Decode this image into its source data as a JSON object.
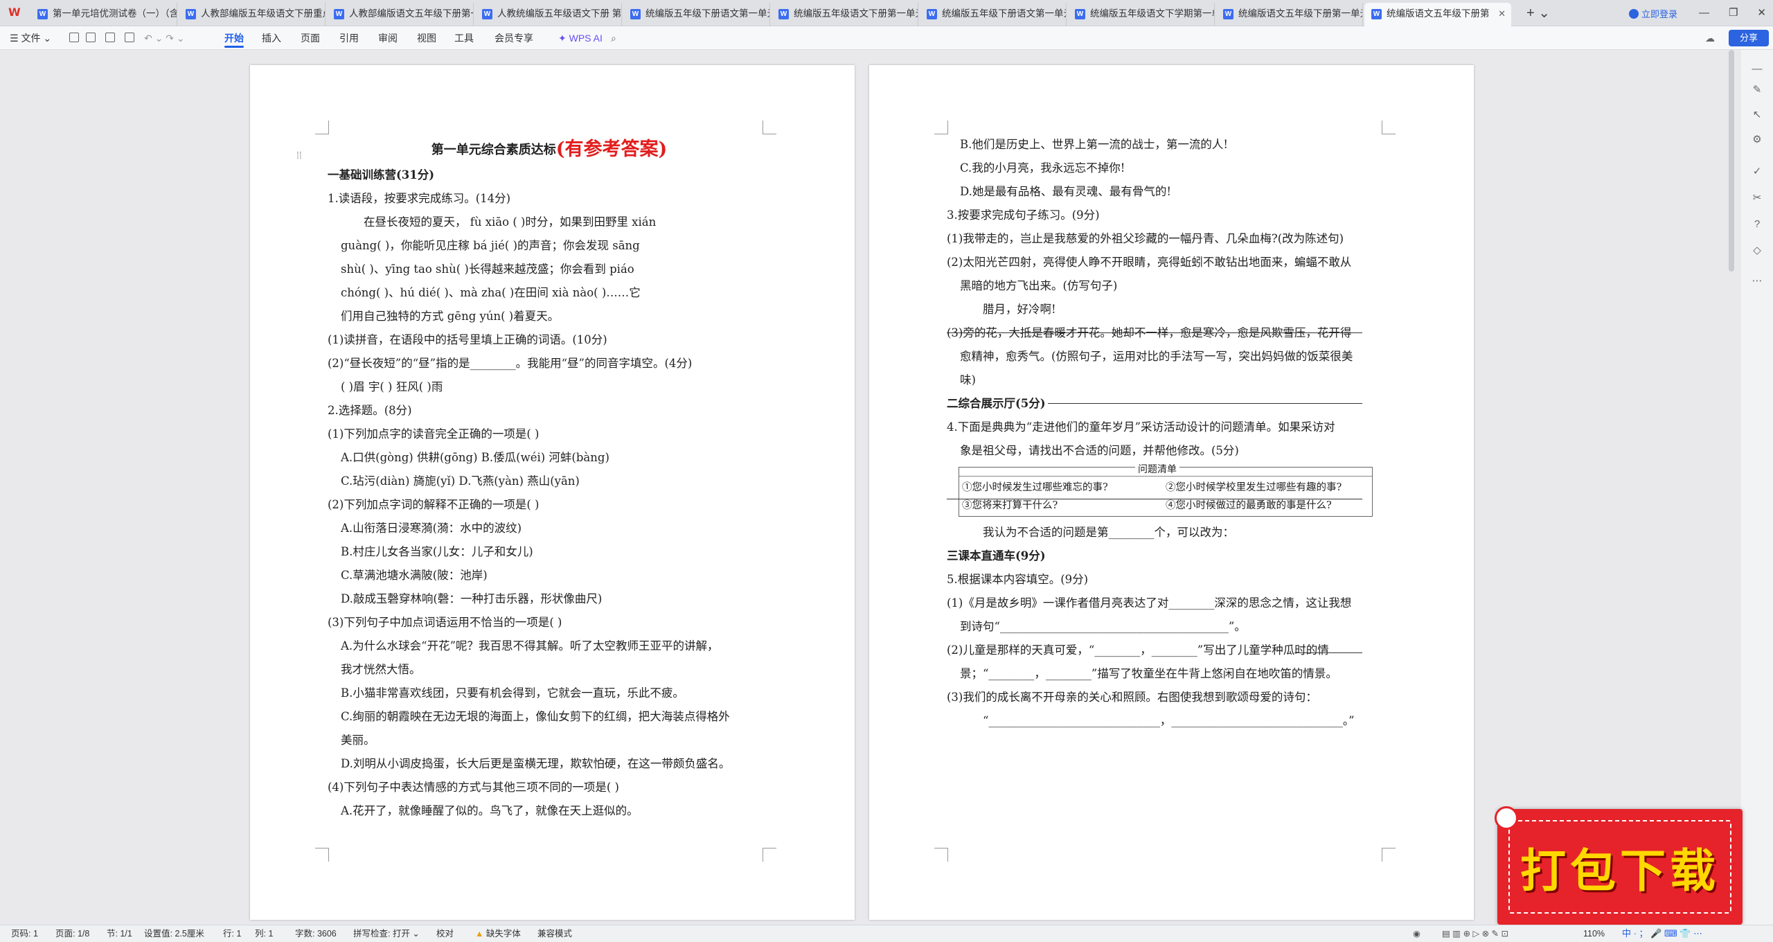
{
  "tabs": [
    {
      "label": "第一单元培优测试卷（一）（含"
    },
    {
      "label": "人教部编版五年级语文下册重点"
    },
    {
      "label": "人教部编版语文五年级下册第一"
    },
    {
      "label": "人教统编版五年级语文下册 第1"
    },
    {
      "label": "统编版五年级下册语文第一单元"
    },
    {
      "label": "统编版五年级语文下册第一单元"
    },
    {
      "label": "统编版五年级下册语文第一单元"
    },
    {
      "label": "统编版五年级语文下学期第一单"
    },
    {
      "label": "统编版语文五年级下册第一单元"
    },
    {
      "label": "统编版语文五年级下册第"
    }
  ],
  "login": "立即登录",
  "menu": {
    "file": "文件",
    "tabs": [
      "开始",
      "插入",
      "页面",
      "引用",
      "审阅",
      "视图",
      "工具",
      "会员专享"
    ],
    "wps_ai": "WPS AI",
    "share": "分享"
  },
  "left": {
    "title": "第一单元综合素质达标",
    "title_red": "(有参考答案)",
    "lines": [
      {
        "c": "h",
        "t": "一基础训练营(31分)"
      },
      {
        "c": "",
        "t": "1.读语段，按要求完成练习。(14分)"
      },
      {
        "c": "ind2",
        "t": "在昼长夜短的夏天，  fù xiāo (          )时分，如果到田野里 xián"
      },
      {
        "c": "ind1",
        "t": "guàng(          )，你能听见庄稼 bá jié(          )的声音；你会发现 sāng"
      },
      {
        "c": "ind1",
        "t": "shù(          )、yīng tao shù(          )长得越来越茂盛；你会看到 piáo"
      },
      {
        "c": "ind1",
        "t": "chóng(          )、hú dié(          )、mà zha(          )在田间 xià nào(          )……它"
      },
      {
        "c": "ind1",
        "t": "们用自己独特的方式 gēng yún(          )着夏天。"
      },
      {
        "c": "",
        "t": "(1)读拼音，在语段中的括号里填上正确的词语。(10分)"
      },
      {
        "c": "",
        "t": "(2)“昼长夜短”的“昼”指的是________。我能用“昼”的同音字填空。(4分)"
      },
      {
        "c": "ind1",
        "t": "(          )眉              宇(          )              狂风(          )雨"
      },
      {
        "c": "",
        "t": "2.选择题。(8分)"
      },
      {
        "c": "",
        "t": "(1)下列加点字的读音完全正确的一项是(      )"
      },
      {
        "c": "ind1",
        "t": "A.口供(gòng)        供耕(gōng) B.倭瓜(wéi)    河蚌(bàng)"
      },
      {
        "c": "ind1",
        "t": "C.玷污(diàn)          旖旎(yǐ)        D.飞燕(yàn)    燕山(yān)"
      },
      {
        "c": "",
        "t": "(2)下列加点字词的解释不正确的一项是(      )"
      },
      {
        "c": "ind1",
        "t": "A.山衔落日浸寒漪(漪：水中的波纹)"
      },
      {
        "c": "ind1",
        "t": "B.村庄儿女各当家(儿女：儿子和女儿)"
      },
      {
        "c": "ind1",
        "t": "C.草满池塘水满陂(陂：池岸)"
      },
      {
        "c": "ind1",
        "t": "D.敲成玉磬穿林响(磬：一种打击乐器，形状像曲尺)"
      },
      {
        "c": "",
        "t": "(3)下列句子中加点词语运用不恰当的一项是(      )"
      },
      {
        "c": "ind1",
        "t": "A.为什么水球会“开花”呢？我百思不得其解。听了太空教师王亚平的讲解，"
      },
      {
        "c": "ind1",
        "t": "   我才恍然大悟。"
      },
      {
        "c": "ind1",
        "t": "B.小猫非常喜欢线团，只要有机会得到，它就会一直玩，乐此不疲。"
      },
      {
        "c": "ind1",
        "t": "C.绚丽的朝霞映在无边无垠的海面上，像仙女剪下的红绸，把大海装点得格外"
      },
      {
        "c": "ind1",
        "t": "   美丽。"
      },
      {
        "c": "ind1",
        "t": "D.刘明从小调皮捣蛋，长大后更是蛮横无理，欺软怕硬，在这一带颇负盛名。"
      },
      {
        "c": "",
        "t": "(4)下列句子中表达情感的方式与其他三项不同的一项是(      )"
      },
      {
        "c": "ind1",
        "t": "A.花开了，就像睡醒了似的。鸟飞了，就像在天上逛似的。"
      }
    ]
  },
  "right": {
    "lines": [
      {
        "c": "ind1",
        "t": "B.他们是历史上、世界上第一流的战士，第一流的人!"
      },
      {
        "c": "ind1",
        "t": "C.我的小月亮，我永远忘不掉你!"
      },
      {
        "c": "ind1",
        "t": "D.她是最有品格、最有灵魂、最有骨气的!"
      },
      {
        "c": "",
        "t": "3.按要求完成句子练习。(9分)"
      },
      {
        "c": "",
        "t": "(1)我带走的，岂止是我慈爱的外祖父珍藏的一幅丹青、几朵血梅?(改为陈述句)"
      },
      {
        "c": "",
        "t": " "
      },
      {
        "c": "",
        "t": "(2)太阳光芒四射，亮得使人睁不开眼睛，亮得蚯蚓不敢钻出地面来，蝙蝠不敢从"
      },
      {
        "c": "ind1",
        "t": "   黑暗的地方飞出来。(仿写句子)"
      },
      {
        "c": "ind2",
        "t": "   腊月，好冷啊!"
      },
      {
        "c": "",
        "t": "(3)旁的花，大抵是春暖才开花。她却不一样，愈是寒冷，愈是风欺雪压，花开得"
      },
      {
        "c": "ind1",
        "t": "   愈精神，愈秀气。(仿照句子，运用对比的手法写一写，突出妈妈做的饭菜很美"
      },
      {
        "c": "ind1",
        "t": "   味)"
      },
      {
        "c": "",
        "t": " "
      },
      {
        "c": "h",
        "t": "二综合展示厅(5分)"
      },
      {
        "c": "",
        "t": "4.下面是典典为“走进他们的童年岁月”采访活动设计的问题清单。如果采访对"
      },
      {
        "c": "ind1",
        "t": "   象是祖父母，请找出不合适的问题，并帮他修改。(5分)"
      }
    ],
    "qbox": {
      "title": "问题清单",
      "q1": "①您小时候发生过哪些难忘的事?",
      "q2": "②您小时候学校里发生过哪些有趣的事?",
      "q3": "③您将来打算干什么?",
      "q4": "④您小时候做过的最勇敢的事是什么?"
    },
    "lines2": [
      {
        "c": "ind2",
        "t": "我认为不合适的问题是第________个，可以改为："
      },
      {
        "c": "h",
        "t": "三课本直通车(9分)"
      },
      {
        "c": "",
        "t": "5.根据课本内容填空。(9分)"
      },
      {
        "c": "",
        "t": "(1)《月是故乡明》一课作者借月亮表达了对________深深的思念之情，这让我想"
      },
      {
        "c": "ind1",
        "t": "   到诗句“________________________________________”。"
      },
      {
        "c": "",
        "t": "(2)儿童是那样的天真可爱，“________，________”写出了儿童学种瓜时的情"
      },
      {
        "c": "ind1",
        "t": "   景；“________，________”描写了牧童坐在牛背上悠闲自在地吹笛的情景。"
      },
      {
        "c": "",
        "t": "(3)我们的成长离不开母亲的关心和照顾。右图使我想到歌颂母爱的诗句："
      },
      {
        "c": "ind2",
        "t": "“______________________________，______________________________。”"
      }
    ]
  },
  "status": {
    "page": "页码: 1",
    "pages": "页面: 1/8",
    "section": "节: 1/1",
    "setting": "设置值: 2.5厘米",
    "row": "行: 1",
    "col": "列: 1",
    "words": "字数: 3606",
    "spell": "拼写检查: 打开",
    "proof": "校对",
    "font": "缺失字体",
    "compat": "兼容模式",
    "zoom": "110%"
  },
  "promo": "打包下载",
  "ime": "中 · ； 🎤 ⌨ 👕 ⋯"
}
